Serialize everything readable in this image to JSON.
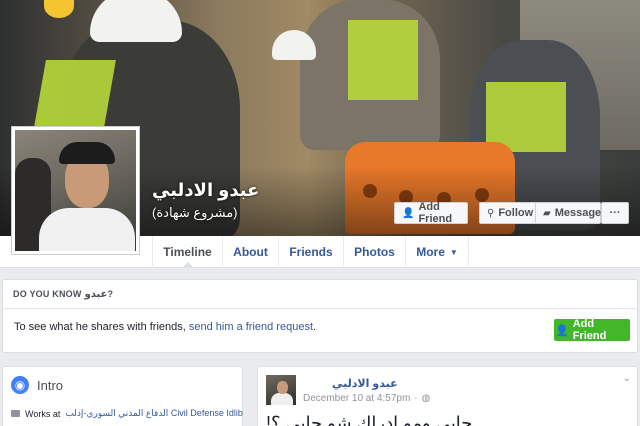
{
  "profile": {
    "name": "عبدو الادلبي",
    "subtitle": "(مشروع شهادة)"
  },
  "actions": {
    "add_friend": "Add Friend",
    "follow": "Follow",
    "message": "Message",
    "more": "···"
  },
  "tabs": [
    {
      "label": "Timeline",
      "active": true
    },
    {
      "label": "About"
    },
    {
      "label": "Friends"
    },
    {
      "label": "Photos"
    },
    {
      "label": "More"
    }
  ],
  "know": {
    "header": "DO YOU KNOW",
    "header_name": "عبدو",
    "header_suffix": "?",
    "text": "To see what he shares with friends,",
    "link": "send him a friend request",
    "text_end": ".",
    "button": "Add Friend"
  },
  "intro": {
    "title": "Intro",
    "works_prefix": "Works at",
    "works_place": "الدفاع المدني السوري-إدلب Civil Defense Idlib"
  },
  "post": {
    "author": "عبدو الادلبي",
    "date": "December 10 at 4:57pm",
    "date_sep": "·",
    "text": "جايي ومو ادراك شو جايي ؟!"
  },
  "colors": {
    "link": "#365899",
    "green": "#42b72a",
    "background": "#e9ebee"
  }
}
